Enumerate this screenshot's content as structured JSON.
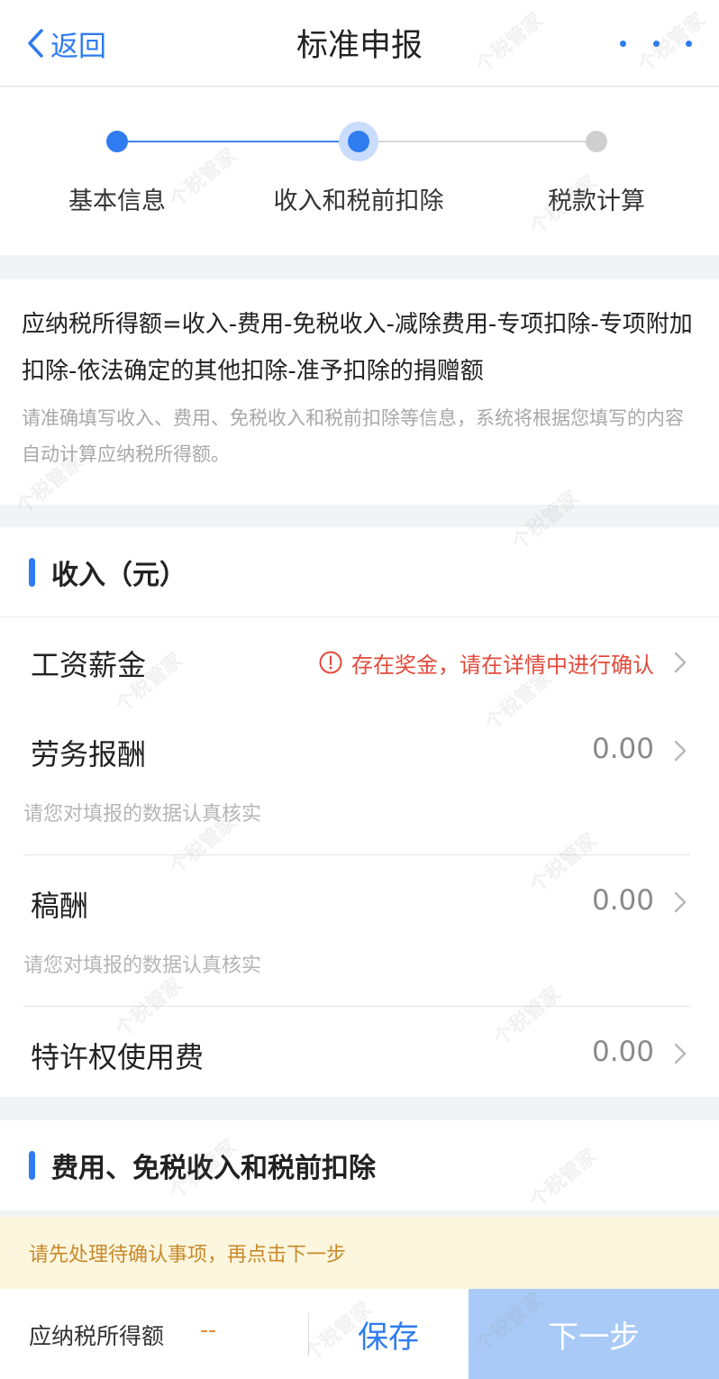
{
  "navbar": {
    "back_label": "返回",
    "title": "标准申报"
  },
  "steps": [
    {
      "label": "基本信息",
      "state": "done"
    },
    {
      "label": "收入和税前扣除",
      "state": "current"
    },
    {
      "label": "税款计算",
      "state": "todo"
    }
  ],
  "formula": {
    "text": "应纳税所得额=收入-费用-免税收入-减除费用-专项扣除-专项附加扣除-依法确定的其他扣除-准予扣除的捐赠额",
    "hint": "请准确填写收入、费用、免税收入和税前扣除等信息，系统将根据您填写的内容自动计算应纳税所得额。"
  },
  "income": {
    "section_title": "收入（元）",
    "items": [
      {
        "name": "工资薪金",
        "warning": "存在奖金，请在详情中进行确认"
      },
      {
        "name": "劳务报酬",
        "value": "0.00",
        "sub": "请您对填报的数据认真核实"
      },
      {
        "name": "稿酬",
        "value": "0.00",
        "sub": "请您对填报的数据认真核实"
      },
      {
        "name": "特许权使用费",
        "value": "0.00"
      }
    ]
  },
  "deductions": {
    "section_title": "费用、免税收入和税前扣除"
  },
  "notice": "请先处理待确认事项，再点击下一步",
  "bottom": {
    "taxable_label": "应纳税所得额",
    "taxable_value": "--",
    "save_label": "保存",
    "next_label": "下一步"
  },
  "watermark": "个税管家",
  "colors": {
    "accent": "#2f7bf0",
    "warning": "#e24a3b",
    "notice_bg": "#fdf6de",
    "notice_text": "#c7892a",
    "next_disabled": "#a9caf6"
  }
}
